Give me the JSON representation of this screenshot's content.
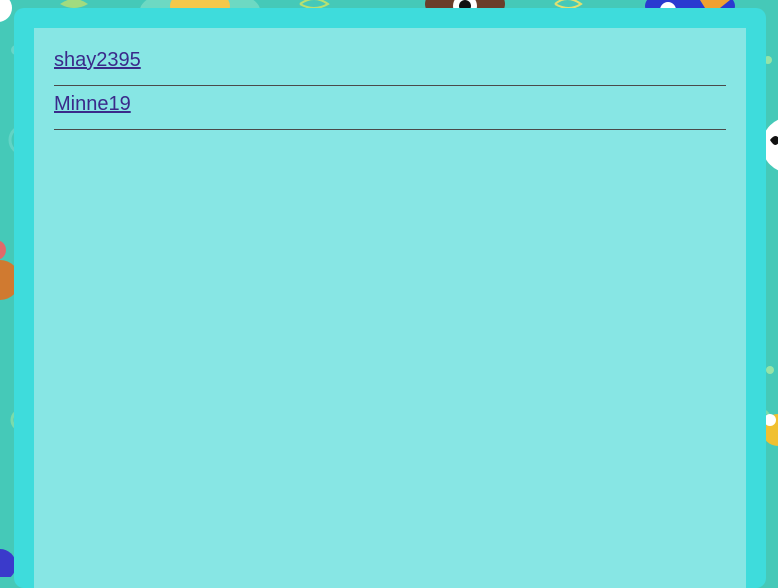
{
  "users": [
    {
      "name": "shay2395"
    },
    {
      "name": "Minne19"
    }
  ],
  "colors": {
    "background": "#45c9b8",
    "outer_panel": "#3edcdc",
    "inner_panel": "#87e6e4",
    "link": "#3a2a8a",
    "divider": "#4a4a4a"
  }
}
